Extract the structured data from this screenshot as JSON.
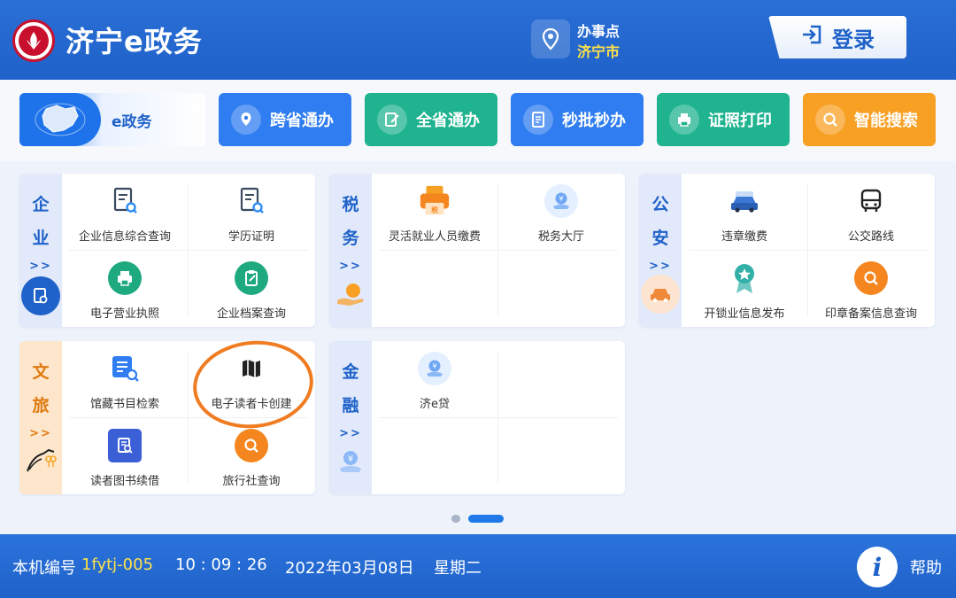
{
  "header": {
    "app_title": "济宁e政务",
    "office_label": "办事点",
    "office_city": "济宁市",
    "login_label": "登录"
  },
  "nav": [
    {
      "label": "e政务",
      "icon": "map-icon",
      "color": "#1e73ea"
    },
    {
      "label": "跨省通办",
      "icon": "location-icon",
      "color": "#2f7df0"
    },
    {
      "label": "全省通办",
      "icon": "edit-icon",
      "color": "#1fb38f"
    },
    {
      "label": "秒批秒办",
      "icon": "document-icon",
      "color": "#2f7df0"
    },
    {
      "label": "证照打印",
      "icon": "printer-icon",
      "color": "#1fb38f"
    },
    {
      "label": "智能搜索",
      "icon": "search-icon",
      "color": "#f8a024"
    }
  ],
  "sections": {
    "enterprise": {
      "title_chars": [
        "企",
        "业"
      ],
      "more": ">>",
      "items": [
        "企业信息综合查询",
        "学历证明",
        "电子营业执照",
        "企业档案查询"
      ]
    },
    "tax": {
      "title_chars": [
        "税",
        "务"
      ],
      "more": ">>",
      "items": [
        "灵活就业人员缴费",
        "税务大厅"
      ]
    },
    "police": {
      "title_chars": [
        "公",
        "安"
      ],
      "more": ">>",
      "items": [
        "违章缴费",
        "公交路线",
        "开锁业信息发布",
        "印章备案信息查询"
      ]
    },
    "culture": {
      "title_chars": [
        "文",
        "旅"
      ],
      "more": ">>",
      "items": [
        "馆藏书目检索",
        "电子读者卡创建",
        "读者图书续借",
        "旅行社查询"
      ]
    },
    "finance": {
      "title_chars": [
        "金",
        "融"
      ],
      "more": ">>",
      "items": [
        "济e贷"
      ]
    }
  },
  "pager": {
    "pages": 2,
    "current": 2
  },
  "footer": {
    "device_label": "本机编号",
    "device_id": "1fytj-005",
    "time": "10 : 09 : 26",
    "date": "2022年03月08日",
    "weekday": "星期二",
    "help_label": "帮助",
    "help_icon_glyph": "i"
  },
  "colors": {
    "primary": "#1f62c9",
    "accent_yellow": "#ffe14a",
    "green": "#1fb38f",
    "orange": "#f8a024",
    "annotation": "#f07c22"
  }
}
